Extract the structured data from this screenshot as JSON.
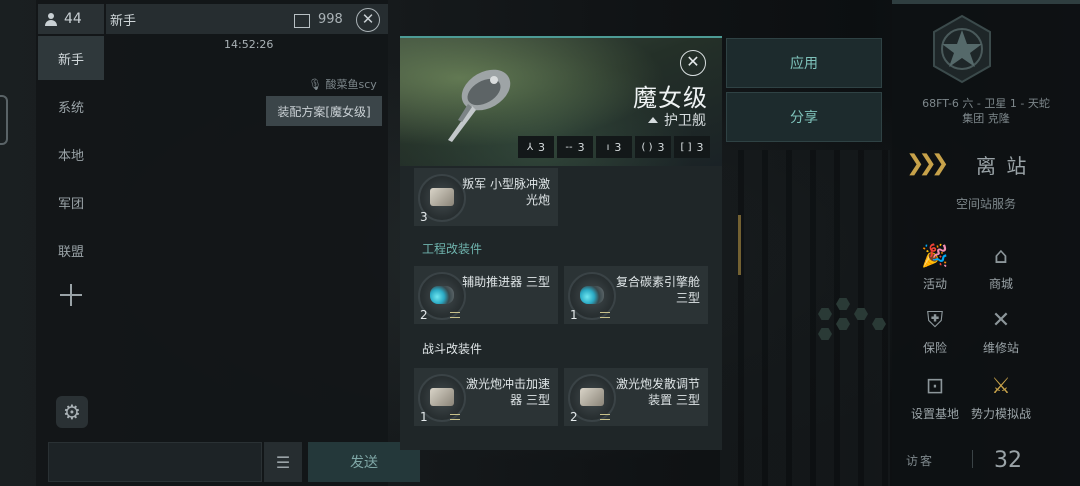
{
  "chat": {
    "member_count": "44",
    "channel_title": "新手",
    "header_number": "998",
    "channels": [
      {
        "label": "新手",
        "active": true
      },
      {
        "label": "系统",
        "active": false
      },
      {
        "label": "本地",
        "active": false
      },
      {
        "label": "军团",
        "active": false
      },
      {
        "label": "联盟",
        "active": false
      }
    ],
    "message": {
      "time": "14:52:26",
      "user": "酸菜鱼scy",
      "text": "装配方案[魔女级]"
    },
    "input_placeholder": "",
    "send_label": "发送"
  },
  "fitting": {
    "ship_name": "魔女级",
    "ship_class": "护卫舰",
    "slots": [
      {
        "icon": "high-slot-icon",
        "glyph": "⅄",
        "count": "3"
      },
      {
        "icon": "mid-slot-icon",
        "glyph": "--",
        "count": "3"
      },
      {
        "icon": "low-slot-icon",
        "glyph": "ı",
        "count": "3"
      },
      {
        "icon": "rig-slot-icon",
        "glyph": "( )",
        "count": "3"
      },
      {
        "icon": "subsystem-slot-icon",
        "glyph": "[ ]",
        "count": "3"
      }
    ],
    "weapon": {
      "name": "叛军 小型脉冲激光炮",
      "qty": "3"
    },
    "engineering_section": "工程改装件",
    "engineering": [
      {
        "name": "辅助推进器 三型",
        "qty": "2"
      },
      {
        "name": "复合碳素引擎舱 三型",
        "qty": "1"
      }
    ],
    "combat_section": "战斗改装件",
    "combat": [
      {
        "name": "激光炮冲击加速器 三型",
        "qty": "1"
      },
      {
        "name": "激光炮发散调节装置 三型",
        "qty": "2"
      }
    ],
    "apply_label": "应用",
    "share_label": "分享"
  },
  "station": {
    "name_line1": "68FT-6 六 - 卫星 1 - 天蛇",
    "name_line2": "集团 克隆",
    "undock_label": "离 站",
    "services_title": "空间站服务",
    "services": [
      {
        "label": "活动",
        "icon": "party-popper-icon"
      },
      {
        "label": "商城",
        "icon": "shop-icon"
      },
      {
        "label": "保险",
        "icon": "insurance-shield-icon"
      },
      {
        "label": "维修站",
        "icon": "repair-tools-icon"
      },
      {
        "label": "设置基地",
        "icon": "base-marker-icon"
      },
      {
        "label": "势力模拟战",
        "icon": "crossed-flags-icon"
      }
    ],
    "visitors_label": "访客",
    "visitors_count": "32"
  },
  "colors": {
    "accent": "#4d9b95",
    "undock_chevron": "#c7a24a"
  }
}
